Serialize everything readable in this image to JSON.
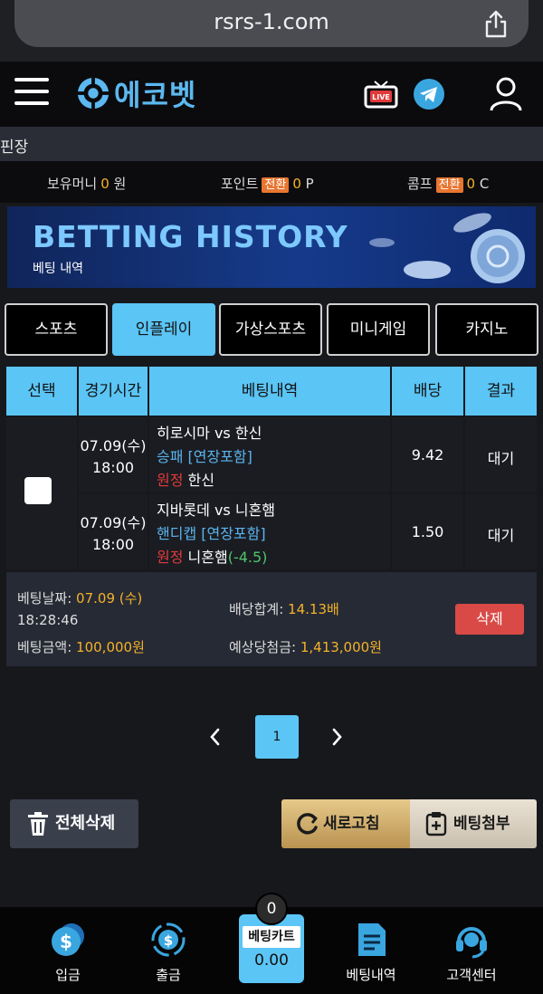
{
  "browser": {
    "url": "rsrs-1.com"
  },
  "header": {
    "logo_text": "에코벳"
  },
  "subnav": {
    "text": "핀장"
  },
  "wallet": {
    "money_label": "보유머니",
    "money_value": "0",
    "money_unit": "원",
    "point_label": "포인트",
    "point_convert": "전환",
    "point_value": "0",
    "point_unit": "P",
    "comp_label": "콤프",
    "comp_convert": "전환",
    "comp_value": "0",
    "comp_unit": "C"
  },
  "banner": {
    "title": "BETTING HISTORY",
    "subtitle": "베팅 내역"
  },
  "tabs": [
    {
      "label": "스포츠",
      "active": false
    },
    {
      "label": "인플레이",
      "active": true
    },
    {
      "label": "가상스포츠",
      "active": false
    },
    {
      "label": "미니게임",
      "active": false
    },
    {
      "label": "카지노",
      "active": false
    }
  ],
  "table": {
    "headers": [
      "선택",
      "경기시간",
      "베팅내역",
      "배당",
      "결과"
    ],
    "rows": [
      {
        "date": "07.09(수)",
        "time": "18:00",
        "match": "히로시마 vs 한신",
        "market": "승패 [연장포함]",
        "side": "원정",
        "pick": "한신",
        "handicap": "",
        "odds": "9.42",
        "result": "대기"
      },
      {
        "date": "07.09(수)",
        "time": "18:00",
        "match": "지바롯데 vs 니혼햄",
        "market": "핸디캡 [연장포함]",
        "side": "원정",
        "pick": "니혼햄",
        "handicap": "(-4.5)",
        "odds": "1.50",
        "result": "대기"
      }
    ]
  },
  "summary": {
    "date_label": "베팅날짜:",
    "date_value": "07.09 (수)",
    "time_value": "18:28:46",
    "amount_label": "베팅금액:",
    "amount_value": "100,000원",
    "odds_label": "배당합계:",
    "odds_value": "14.13배",
    "win_label": "예상당첨금:",
    "win_value": "1,413,000원",
    "delete_label": "삭제"
  },
  "pagination": {
    "current": "1"
  },
  "actions": {
    "delete_all": "전체삭제",
    "refresh": "새로고침",
    "attach": "베팅첨부"
  },
  "bottom_nav": {
    "deposit": "입금",
    "withdraw": "출금",
    "cart_label": "베팅카트",
    "cart_value": "0.00",
    "cart_count": "0",
    "history": "베팅내역",
    "support": "고객센터"
  },
  "colors": {
    "accent": "#5bc5f5",
    "highlight": "#f5b229",
    "danger": "#d94a46",
    "convert": "#e87630"
  }
}
